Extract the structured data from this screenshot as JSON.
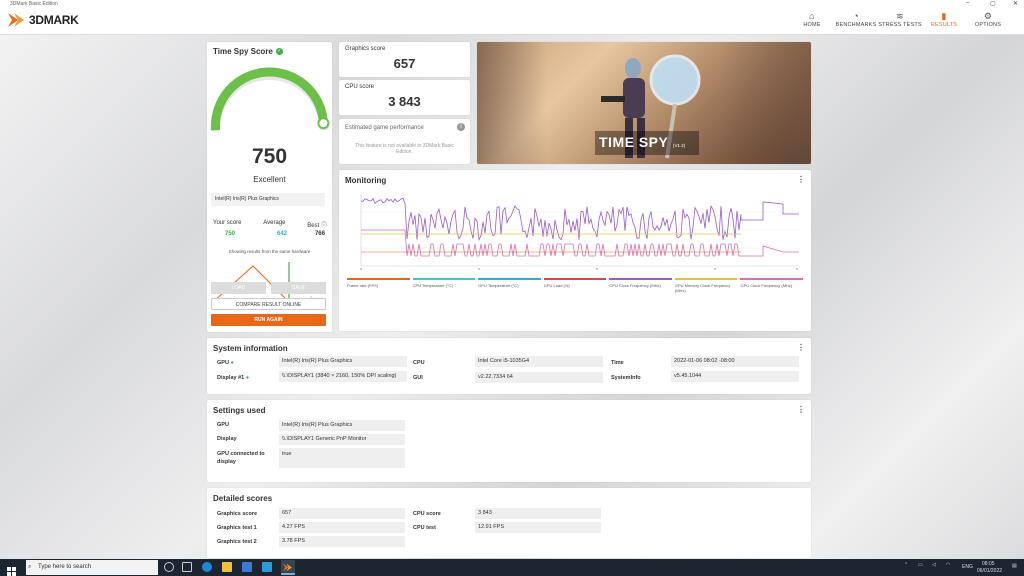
{
  "window": {
    "title": "3DMark Basic Edition"
  },
  "brand": {
    "name": "3DMARK",
    "accent": "#e8681a"
  },
  "nav": [
    {
      "label": "HOME",
      "icon": "⌂",
      "active": false
    },
    {
      "label": "BENCHMARKS",
      "icon": "◔",
      "active": false
    },
    {
      "label": "STRESS TESTS",
      "icon": "≋",
      "active": false
    },
    {
      "label": "RESULTS",
      "icon": "▮",
      "active": true
    },
    {
      "label": "OPTIONS",
      "icon": "⚙",
      "active": false
    }
  ],
  "score_card": {
    "title": "Time Spy Score",
    "score": "750",
    "rating": "Excellent",
    "gpu": "Intel(R) Iris(R) Plus Graphics",
    "your_score_label": "Your score",
    "your_score": "750",
    "average_label": "Average",
    "average": "642",
    "best_label": "Best",
    "best": "766",
    "note": "Showing results from the same hardware",
    "load_label": "LOAD",
    "save_label": "SAVE",
    "compare_label": "COMPARE RESULT ONLINE",
    "run_label": "RUN AGAIN",
    "gauge_fraction": 0.96
  },
  "graphics_score": {
    "label": "Graphics score",
    "value": "657"
  },
  "cpu_score": {
    "label": "CPU score",
    "value": "3 843"
  },
  "estimated": {
    "label": "Estimated game performance",
    "note": "This feature is not available in 3DMark Basic Edition."
  },
  "hero": {
    "title": "TIME SPY",
    "version": "(V1.2)"
  },
  "monitoring": {
    "title": "Monitoring",
    "legend": [
      {
        "label": "Frame rate (FPS)",
        "color": "#e8681a"
      },
      {
        "label": "CPU Temperature (°C)",
        "color": "#3cc9c0"
      },
      {
        "label": "GPU Temperature (°C)",
        "color": "#2ab0d8"
      },
      {
        "label": "GPU Load (%)",
        "color": "#d84a4a"
      },
      {
        "label": "CPU Clock Frequency (MHz)",
        "color": "#9a5bd0"
      },
      {
        "label": "GPU Memory Clock Frequency (MHz)",
        "color": "#e6c040"
      },
      {
        "label": "GPU Clock Frequency (MHz)",
        "color": "#d870b8"
      }
    ]
  },
  "system_info": {
    "title": "System information",
    "gpu_label": "GPU",
    "gpu": "Intel(R) Iris(R) Plus Graphics",
    "display_label": "Display #1",
    "display": "\\\\.\\DISPLAY1 (3840 × 2160, 150% DPI scaling)",
    "cpu_label": "CPU",
    "cpu": "Intel Core i5-1035G4",
    "gui_label": "GUI",
    "gui": "v2.22.7334 64",
    "time_label": "Time",
    "time": "2022-01-06 08:02 -08:00",
    "sysinfo_label": "SystemInfo",
    "sysinfo": "v5.45.1044"
  },
  "settings": {
    "title": "Settings used",
    "gpu_label": "GPU",
    "gpu": "Intel(R) Iris(R) Plus Graphics",
    "display_label": "Display",
    "display": "\\\\.\\DISPLAY1 Generic PnP Monitor",
    "connected_label": "GPU connected to display",
    "connected": "true"
  },
  "detailed": {
    "title": "Detailed scores",
    "graphics_score_label": "Graphics score",
    "graphics_score": "657",
    "gt1_label": "Graphics test 1",
    "gt1": "4.27 FPS",
    "gt2_label": "Graphics test 2",
    "gt2": "3.78 FPS",
    "cpu_score_label": "CPU score",
    "cpu_score": "3 843",
    "cpu_test_label": "CPU test",
    "cpu_test": "12.91 FPS"
  },
  "taskbar": {
    "search_placeholder": "Type here to search",
    "lang": "ENG",
    "time": "08:05",
    "date": "06/01/2022"
  }
}
